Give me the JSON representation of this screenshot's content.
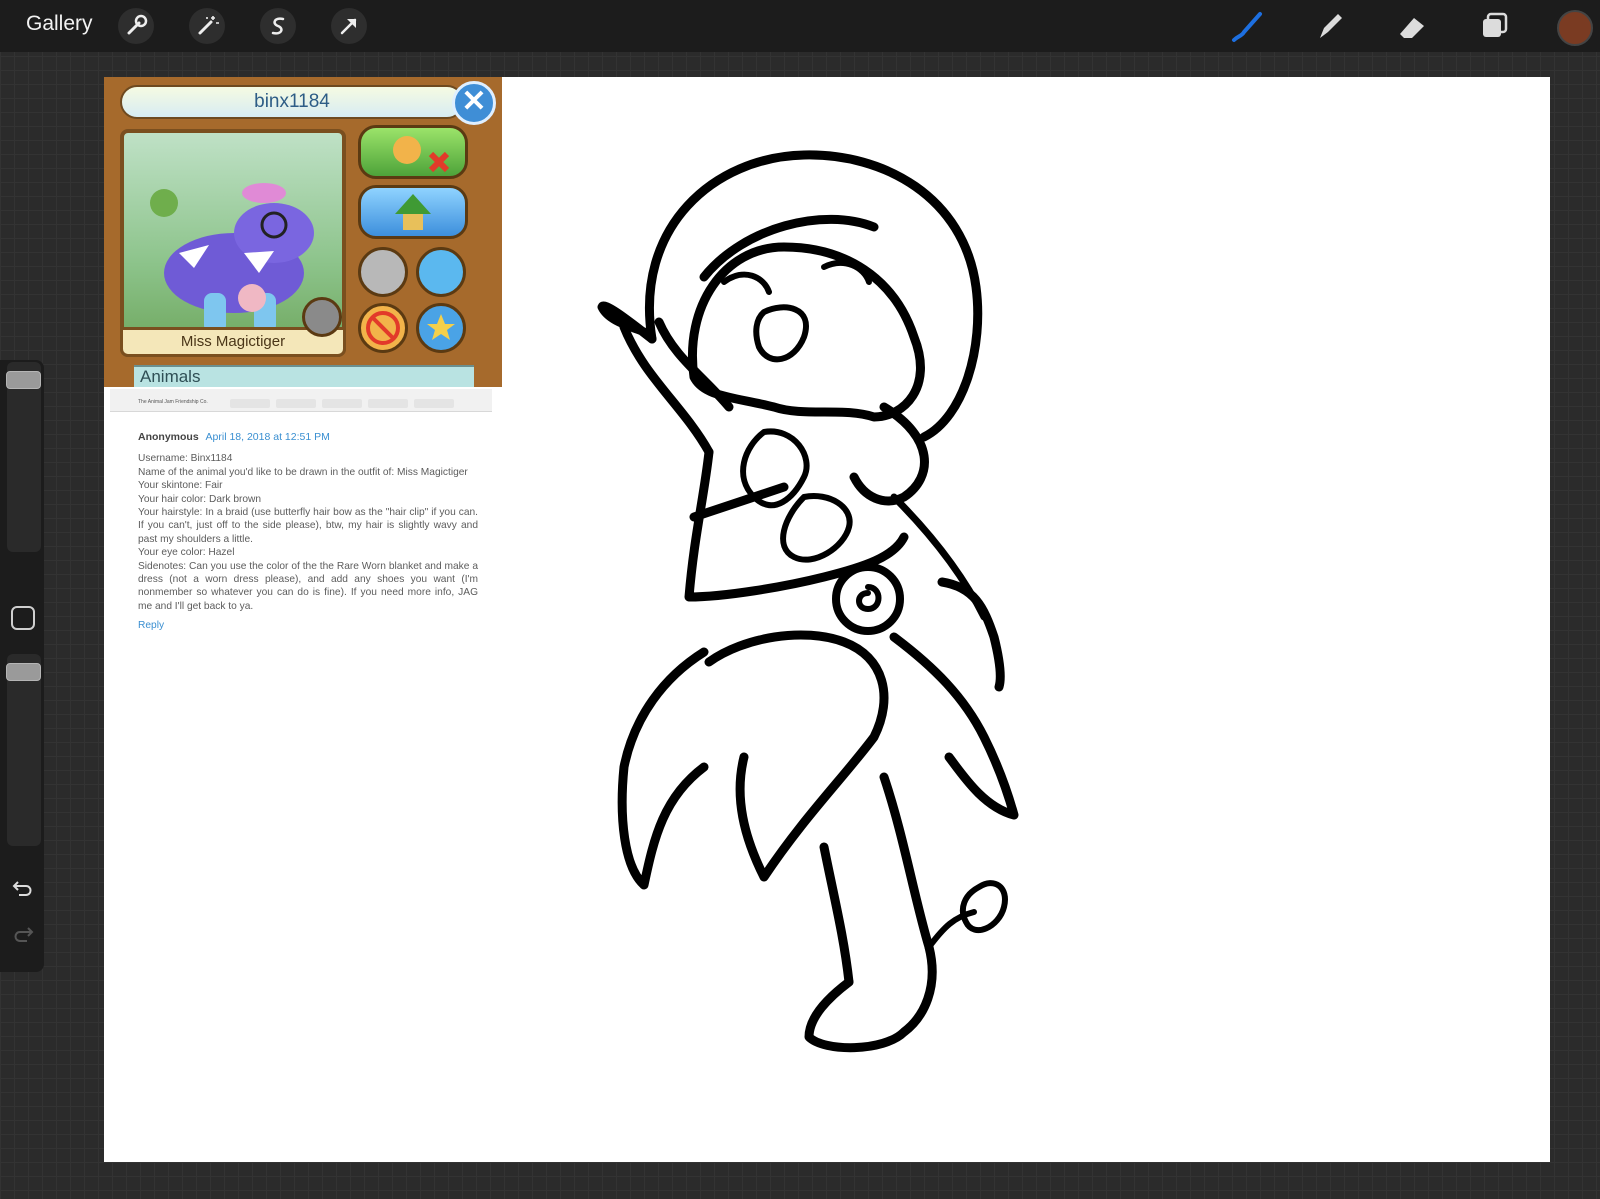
{
  "toolbar": {
    "gallery_label": "Gallery",
    "left_tools": [
      "wrench-icon",
      "magic-wand-icon",
      "selection-icon",
      "transform-arrow-icon"
    ],
    "right_tools": [
      "brush-icon",
      "smudge-icon",
      "eraser-icon",
      "layers-icon"
    ],
    "active_tool": "brush-icon",
    "accent_color": "#1d6fe0",
    "current_color": "#7a3b22"
  },
  "sidebar": {
    "brush_size_level": 0.95,
    "opacity_level": 0.95,
    "undo_icon": "undo-icon",
    "redo_icon": "redo-icon"
  },
  "reference": {
    "username": "binx1184",
    "pet_name": "Miss Magictiger",
    "section_label": "Animals",
    "close_icon": "close-x-icon",
    "browser_tab_title": "The Animal Jam Friendship Co..."
  },
  "comment": {
    "author": "Anonymous",
    "date": "April 18, 2018 at 12:51 PM",
    "lines": [
      "Username: Binx1184",
      "Name of the animal you'd like to be drawn in the outfit of: Miss Magictiger",
      "Your skintone: Fair",
      "Your hair color: Dark brown",
      "Your hairstyle: In a braid (use butterfly hair bow as the \"hair clip\" if you can. If you can't, just off to the side please), btw, my hair is slightly wavy and past my shoulders a little.",
      "Your eye color: Hazel",
      "Sidenotes: Can you use the color of the the Rare Worn blanket and make a dress (not a worn dress please), and add any shoes you want (I'm nonmember so whatever you can do is fine). If you need more info, JAG me and I'll get back to ya."
    ],
    "reply_label": "Reply"
  }
}
